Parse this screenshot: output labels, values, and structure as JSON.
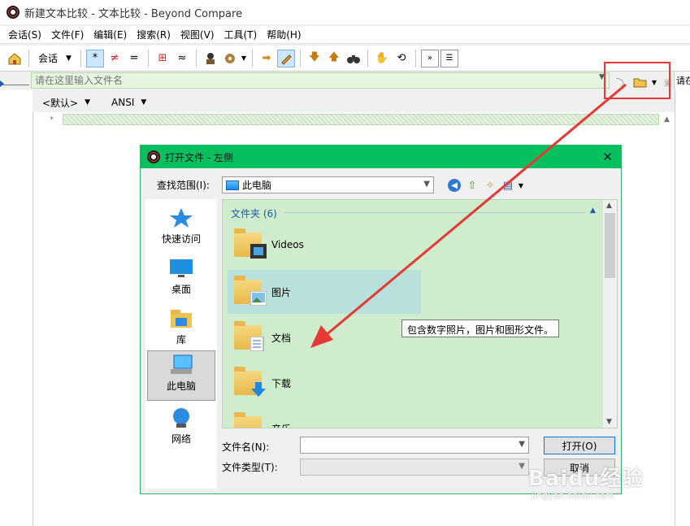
{
  "window": {
    "title": "新建文本比较 - 文本比较 - Beyond Compare"
  },
  "menubar": {
    "items": [
      "会话(S)",
      "文件(F)",
      "编辑(E)",
      "搜索(R)",
      "视图(V)",
      "工具(T)",
      "帮助(H)"
    ]
  },
  "toolbar": {
    "session_label": "会话"
  },
  "pathbar": {
    "left_placeholder": "请在这里输入文件名",
    "right_placeholder": "请在"
  },
  "encoding": {
    "format": "<默认>",
    "charset": "ANSI"
  },
  "dialog": {
    "title": "打开文件 - 左侧",
    "look_in_label": "查找范围(I):",
    "look_in_value": "此电脑",
    "places": [
      {
        "label": "快速访问",
        "icon": "star-icon"
      },
      {
        "label": "桌面",
        "icon": "desktop-icon"
      },
      {
        "label": "库",
        "icon": "library-icon"
      },
      {
        "label": "此电脑",
        "icon": "computer-icon",
        "selected": true
      },
      {
        "label": "网络",
        "icon": "network-icon"
      }
    ],
    "group_header": "文件夹 (6)",
    "folders": [
      {
        "name": "Videos",
        "icon": "videos-folder-icon"
      },
      {
        "name": "图片",
        "icon": "pictures-folder-icon"
      },
      {
        "name": "文档",
        "icon": "documents-folder-icon"
      },
      {
        "name": "下载",
        "icon": "downloads-folder-icon"
      },
      {
        "name": "音乐",
        "icon": "music-folder-icon"
      }
    ],
    "tooltip": "包含数字照片，图片和图形文件。",
    "filename_label": "文件名(N):",
    "filename_value": "",
    "filetype_label": "文件类型(T):",
    "filetype_value": "",
    "open_button": "打开(O)",
    "cancel_button": "取消"
  },
  "watermark": {
    "main": "Baidu经验",
    "sub": "jingyan.baidu.com"
  },
  "colors": {
    "dialog_title_bg": "#06c060",
    "filelist_bg": "#cfeccd",
    "path_input_bg": "#e6f5e0",
    "highlight_box": "#e53935",
    "arrow": "#e53935"
  }
}
